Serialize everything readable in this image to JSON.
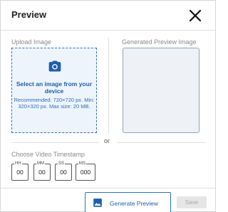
{
  "dialog": {
    "title": "Preview",
    "close_icon": "close-icon"
  },
  "upload": {
    "label": "Upload Image",
    "icon": "camera-icon",
    "heading": "Select an image from your device",
    "description": "Recommended: 720×720 px. Min: 320×320 px. Max size: 20 MB."
  },
  "preview": {
    "label": "Generated Preview Image"
  },
  "separator_text": "or",
  "timestamp": {
    "label": "Choose Video Timestamp",
    "fields": [
      {
        "unit": "HH",
        "value": "00"
      },
      {
        "unit": "MM",
        "value": "00"
      },
      {
        "unit": "SS",
        "value": "00"
      },
      {
        "unit": "MS",
        "value": "000"
      }
    ]
  },
  "actions": {
    "generate_label": "Generate Preview",
    "generate_icon": "image-icon",
    "save_label": "Save"
  },
  "colors": {
    "accent": "#1f5fa8",
    "upload_bg": "#eef4fb",
    "disabled_bg": "#e6e6e6"
  }
}
